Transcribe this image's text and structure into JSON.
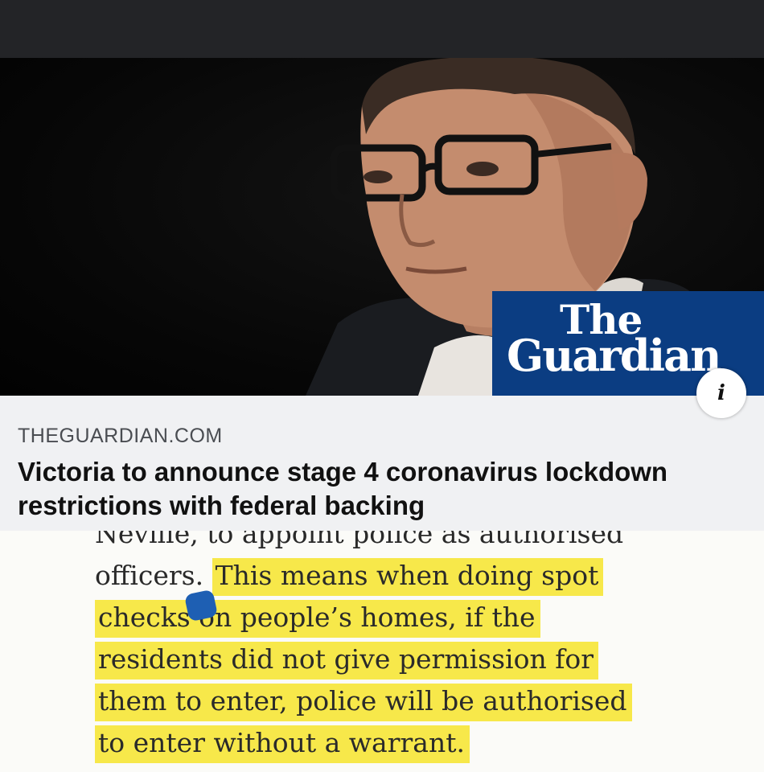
{
  "hero": {
    "badge_line1": "The",
    "badge_line2": "Guardian",
    "info_icon": "i",
    "badge_color": "#0b3d82"
  },
  "link_card": {
    "domain": "THEGUARDIAN.COM",
    "headline": "Victoria to announce stage 4 coronavirus lockdown restrictions with federal backing"
  },
  "article": {
    "line_partial": "Neville, to appoint police as authorised",
    "line1_plain": "officers.",
    "line1_highlight": "This means when doing spot",
    "line2_highlight": "checks on people’s homes, if the",
    "line3_highlight": "residents did not give permission for",
    "line4_highlight": "them to enter, police will be authorised",
    "line5_highlight": "to enter without a warrant.",
    "highlight_color": "#f7e84a"
  },
  "icons": {
    "info": "info-icon",
    "selection_handle": "text-selection-handle-icon"
  }
}
